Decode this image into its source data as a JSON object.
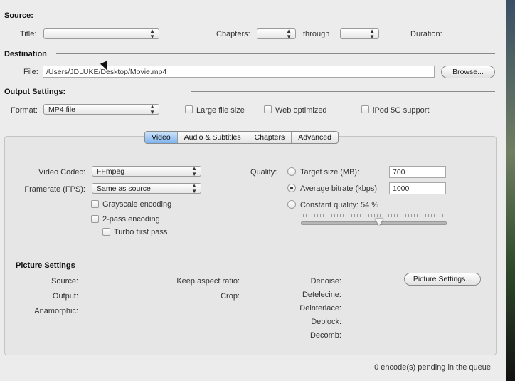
{
  "source": {
    "heading": "Source:",
    "title_label": "Title:",
    "title_value": "",
    "chapters_label": "Chapters:",
    "chapters_start": "",
    "through_label": "through",
    "chapters_end": "",
    "duration_label": "Duration:",
    "duration_value": ""
  },
  "destination": {
    "heading": "Destination",
    "file_label": "File:",
    "file_value": "/Users/JDLUKE/Desktop/Movie.mp4",
    "browse_label": "Browse..."
  },
  "output": {
    "heading": "Output Settings:",
    "format_label": "Format:",
    "format_value": "MP4 file",
    "large_file": "Large file size",
    "web_optimized": "Web optimized",
    "ipod": "iPod 5G support"
  },
  "tabs": [
    "Video",
    "Audio & Subtitles",
    "Chapters",
    "Advanced"
  ],
  "selected_tab": "Video",
  "video": {
    "codec_label": "Video Codec:",
    "codec_value": "FFmpeg",
    "framerate_label": "Framerate (FPS):",
    "framerate_value": "Same as source",
    "grayscale": "Grayscale encoding",
    "twopass": "2-pass encoding",
    "turbo": "Turbo first pass",
    "quality_label": "Quality:",
    "target_size": "Target size (MB):",
    "target_size_value": "700",
    "avg_bitrate": "Average bitrate (kbps):",
    "avg_bitrate_value": "1000",
    "constant_quality": "Constant quality: 54 %",
    "selected_quality_mode": "avg_bitrate",
    "quality_slider_percent": 54
  },
  "picture": {
    "heading": "Picture Settings",
    "source": "Source:",
    "output": "Output:",
    "anamorphic": "Anamorphic:",
    "keep_aspect": "Keep aspect ratio:",
    "crop": "Crop:",
    "denoise": "Denoise:",
    "detelecine": "Detelecine:",
    "deinterlace": "Deinterlace:",
    "deblock": "Deblock:",
    "decomb": "Decomb:",
    "button": "Picture Settings..."
  },
  "status_text": "0 encode(s) pending in the queue"
}
